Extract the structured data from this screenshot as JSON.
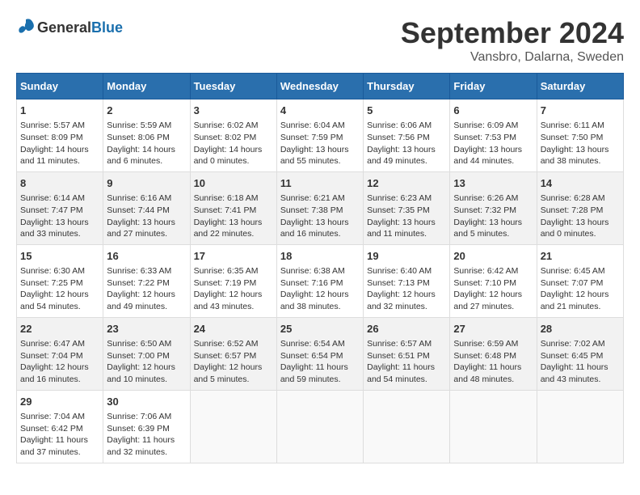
{
  "logo": {
    "general": "General",
    "blue": "Blue"
  },
  "title": "September 2024",
  "location": "Vansbro, Dalarna, Sweden",
  "headers": [
    "Sunday",
    "Monday",
    "Tuesday",
    "Wednesday",
    "Thursday",
    "Friday",
    "Saturday"
  ],
  "weeks": [
    [
      {
        "day": "1",
        "sunrise": "Sunrise: 5:57 AM",
        "sunset": "Sunset: 8:09 PM",
        "daylight": "Daylight: 14 hours and 11 minutes."
      },
      {
        "day": "2",
        "sunrise": "Sunrise: 5:59 AM",
        "sunset": "Sunset: 8:06 PM",
        "daylight": "Daylight: 14 hours and 6 minutes."
      },
      {
        "day": "3",
        "sunrise": "Sunrise: 6:02 AM",
        "sunset": "Sunset: 8:02 PM",
        "daylight": "Daylight: 14 hours and 0 minutes."
      },
      {
        "day": "4",
        "sunrise": "Sunrise: 6:04 AM",
        "sunset": "Sunset: 7:59 PM",
        "daylight": "Daylight: 13 hours and 55 minutes."
      },
      {
        "day": "5",
        "sunrise": "Sunrise: 6:06 AM",
        "sunset": "Sunset: 7:56 PM",
        "daylight": "Daylight: 13 hours and 49 minutes."
      },
      {
        "day": "6",
        "sunrise": "Sunrise: 6:09 AM",
        "sunset": "Sunset: 7:53 PM",
        "daylight": "Daylight: 13 hours and 44 minutes."
      },
      {
        "day": "7",
        "sunrise": "Sunrise: 6:11 AM",
        "sunset": "Sunset: 7:50 PM",
        "daylight": "Daylight: 13 hours and 38 minutes."
      }
    ],
    [
      {
        "day": "8",
        "sunrise": "Sunrise: 6:14 AM",
        "sunset": "Sunset: 7:47 PM",
        "daylight": "Daylight: 13 hours and 33 minutes."
      },
      {
        "day": "9",
        "sunrise": "Sunrise: 6:16 AM",
        "sunset": "Sunset: 7:44 PM",
        "daylight": "Daylight: 13 hours and 27 minutes."
      },
      {
        "day": "10",
        "sunrise": "Sunrise: 6:18 AM",
        "sunset": "Sunset: 7:41 PM",
        "daylight": "Daylight: 13 hours and 22 minutes."
      },
      {
        "day": "11",
        "sunrise": "Sunrise: 6:21 AM",
        "sunset": "Sunset: 7:38 PM",
        "daylight": "Daylight: 13 hours and 16 minutes."
      },
      {
        "day": "12",
        "sunrise": "Sunrise: 6:23 AM",
        "sunset": "Sunset: 7:35 PM",
        "daylight": "Daylight: 13 hours and 11 minutes."
      },
      {
        "day": "13",
        "sunrise": "Sunrise: 6:26 AM",
        "sunset": "Sunset: 7:32 PM",
        "daylight": "Daylight: 13 hours and 5 minutes."
      },
      {
        "day": "14",
        "sunrise": "Sunrise: 6:28 AM",
        "sunset": "Sunset: 7:28 PM",
        "daylight": "Daylight: 13 hours and 0 minutes."
      }
    ],
    [
      {
        "day": "15",
        "sunrise": "Sunrise: 6:30 AM",
        "sunset": "Sunset: 7:25 PM",
        "daylight": "Daylight: 12 hours and 54 minutes."
      },
      {
        "day": "16",
        "sunrise": "Sunrise: 6:33 AM",
        "sunset": "Sunset: 7:22 PM",
        "daylight": "Daylight: 12 hours and 49 minutes."
      },
      {
        "day": "17",
        "sunrise": "Sunrise: 6:35 AM",
        "sunset": "Sunset: 7:19 PM",
        "daylight": "Daylight: 12 hours and 43 minutes."
      },
      {
        "day": "18",
        "sunrise": "Sunrise: 6:38 AM",
        "sunset": "Sunset: 7:16 PM",
        "daylight": "Daylight: 12 hours and 38 minutes."
      },
      {
        "day": "19",
        "sunrise": "Sunrise: 6:40 AM",
        "sunset": "Sunset: 7:13 PM",
        "daylight": "Daylight: 12 hours and 32 minutes."
      },
      {
        "day": "20",
        "sunrise": "Sunrise: 6:42 AM",
        "sunset": "Sunset: 7:10 PM",
        "daylight": "Daylight: 12 hours and 27 minutes."
      },
      {
        "day": "21",
        "sunrise": "Sunrise: 6:45 AM",
        "sunset": "Sunset: 7:07 PM",
        "daylight": "Daylight: 12 hours and 21 minutes."
      }
    ],
    [
      {
        "day": "22",
        "sunrise": "Sunrise: 6:47 AM",
        "sunset": "Sunset: 7:04 PM",
        "daylight": "Daylight: 12 hours and 16 minutes."
      },
      {
        "day": "23",
        "sunrise": "Sunrise: 6:50 AM",
        "sunset": "Sunset: 7:00 PM",
        "daylight": "Daylight: 12 hours and 10 minutes."
      },
      {
        "day": "24",
        "sunrise": "Sunrise: 6:52 AM",
        "sunset": "Sunset: 6:57 PM",
        "daylight": "Daylight: 12 hours and 5 minutes."
      },
      {
        "day": "25",
        "sunrise": "Sunrise: 6:54 AM",
        "sunset": "Sunset: 6:54 PM",
        "daylight": "Daylight: 11 hours and 59 minutes."
      },
      {
        "day": "26",
        "sunrise": "Sunrise: 6:57 AM",
        "sunset": "Sunset: 6:51 PM",
        "daylight": "Daylight: 11 hours and 54 minutes."
      },
      {
        "day": "27",
        "sunrise": "Sunrise: 6:59 AM",
        "sunset": "Sunset: 6:48 PM",
        "daylight": "Daylight: 11 hours and 48 minutes."
      },
      {
        "day": "28",
        "sunrise": "Sunrise: 7:02 AM",
        "sunset": "Sunset: 6:45 PM",
        "daylight": "Daylight: 11 hours and 43 minutes."
      }
    ],
    [
      {
        "day": "29",
        "sunrise": "Sunrise: 7:04 AM",
        "sunset": "Sunset: 6:42 PM",
        "daylight": "Daylight: 11 hours and 37 minutes."
      },
      {
        "day": "30",
        "sunrise": "Sunrise: 7:06 AM",
        "sunset": "Sunset: 6:39 PM",
        "daylight": "Daylight: 11 hours and 32 minutes."
      },
      null,
      null,
      null,
      null,
      null
    ]
  ]
}
